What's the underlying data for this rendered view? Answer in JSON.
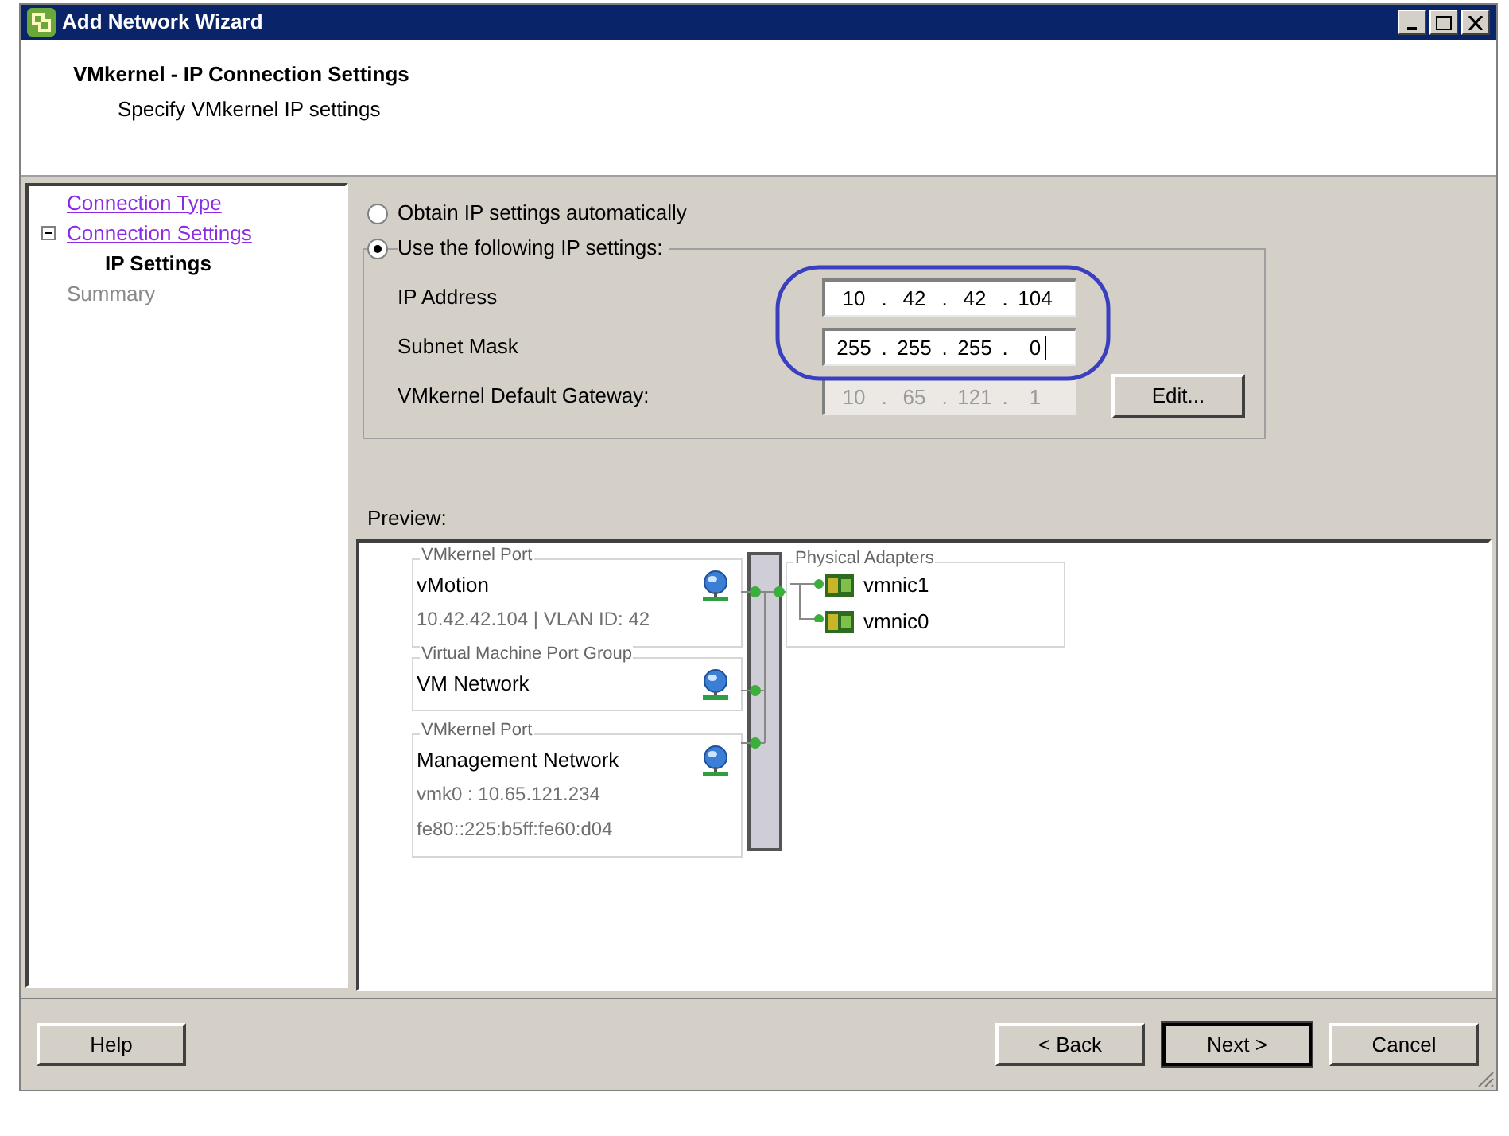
{
  "window": {
    "title": "Add Network Wizard"
  },
  "header": {
    "title": "VMkernel - IP Connection Settings",
    "subtitle": "Specify VMkernel IP settings"
  },
  "steps": [
    {
      "label": "Connection Type",
      "kind": "link"
    },
    {
      "label": "Connection Settings",
      "kind": "link",
      "expanded": true,
      "children": [
        {
          "label": "IP Settings",
          "kind": "current"
        }
      ]
    },
    {
      "label": "Summary",
      "kind": "upcoming"
    }
  ],
  "ip_mode": [
    {
      "label": "Obtain IP settings automatically",
      "selected": false
    },
    {
      "label": "Use the following IP settings:",
      "selected": true
    }
  ],
  "fields": [
    {
      "label": "IP Address",
      "octets": [
        "10",
        "42",
        "42",
        "104"
      ],
      "separator": ".",
      "disabled": false
    },
    {
      "label": "Subnet Mask",
      "octets": [
        "255",
        "255",
        "255",
        "0"
      ],
      "separator": ".",
      "disabled": false,
      "caret": true
    },
    {
      "label": "VMkernel Default Gateway:",
      "octets": [
        "10",
        "65",
        "121",
        "1"
      ],
      "separator": ".",
      "disabled": true
    }
  ],
  "edit_button": "Edit...",
  "preview": {
    "label": "Preview:",
    "port_groups": [
      {
        "legend": "VMkernel Port",
        "name": "vMotion",
        "details": [
          "10.42.42.104 | VLAN ID: 42"
        ]
      },
      {
        "legend": "Virtual Machine Port Group",
        "name": "VM Network"
      },
      {
        "legend": "VMkernel Port",
        "name": "Management Network",
        "details": [
          "vmk0 : 10.65.121.234",
          "fe80::225:b5ff:fe60:d04"
        ]
      }
    ],
    "adapters": {
      "legend": "Physical Adapters",
      "items": [
        "vmnic1",
        "vmnic0"
      ]
    }
  },
  "buttons": {
    "help": "Help",
    "back": "< Back",
    "next": "Next >",
    "cancel": "Cancel"
  }
}
